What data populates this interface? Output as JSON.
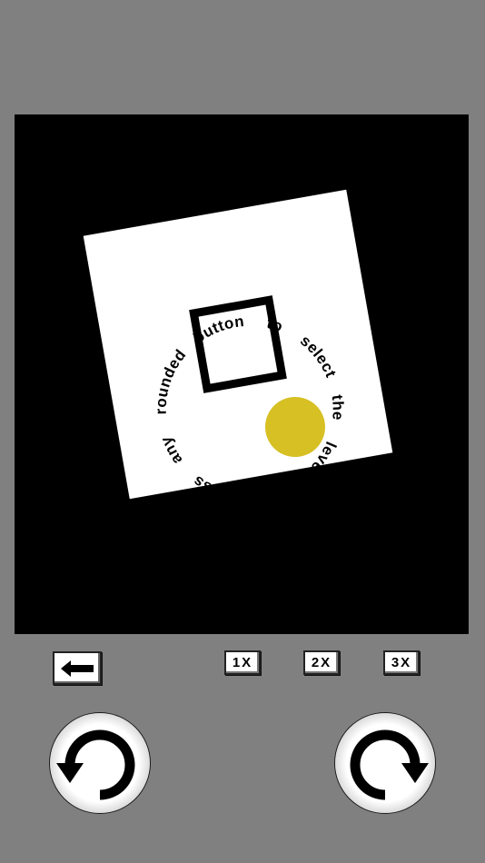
{
  "puzzle": {
    "words": [
      "Press",
      "any",
      "rounded",
      "button",
      "to",
      "select",
      "the",
      "level."
    ],
    "card_color": "#ffffff",
    "marker_color": "#d6c023",
    "background_color": "#000000"
  },
  "controls": {
    "back_icon": "left-arrow-icon",
    "speed_buttons": [
      "1X",
      "2X",
      "3X"
    ],
    "rotate_left_icon": "rotate-counterclockwise-icon",
    "rotate_right_icon": "rotate-clockwise-icon"
  }
}
